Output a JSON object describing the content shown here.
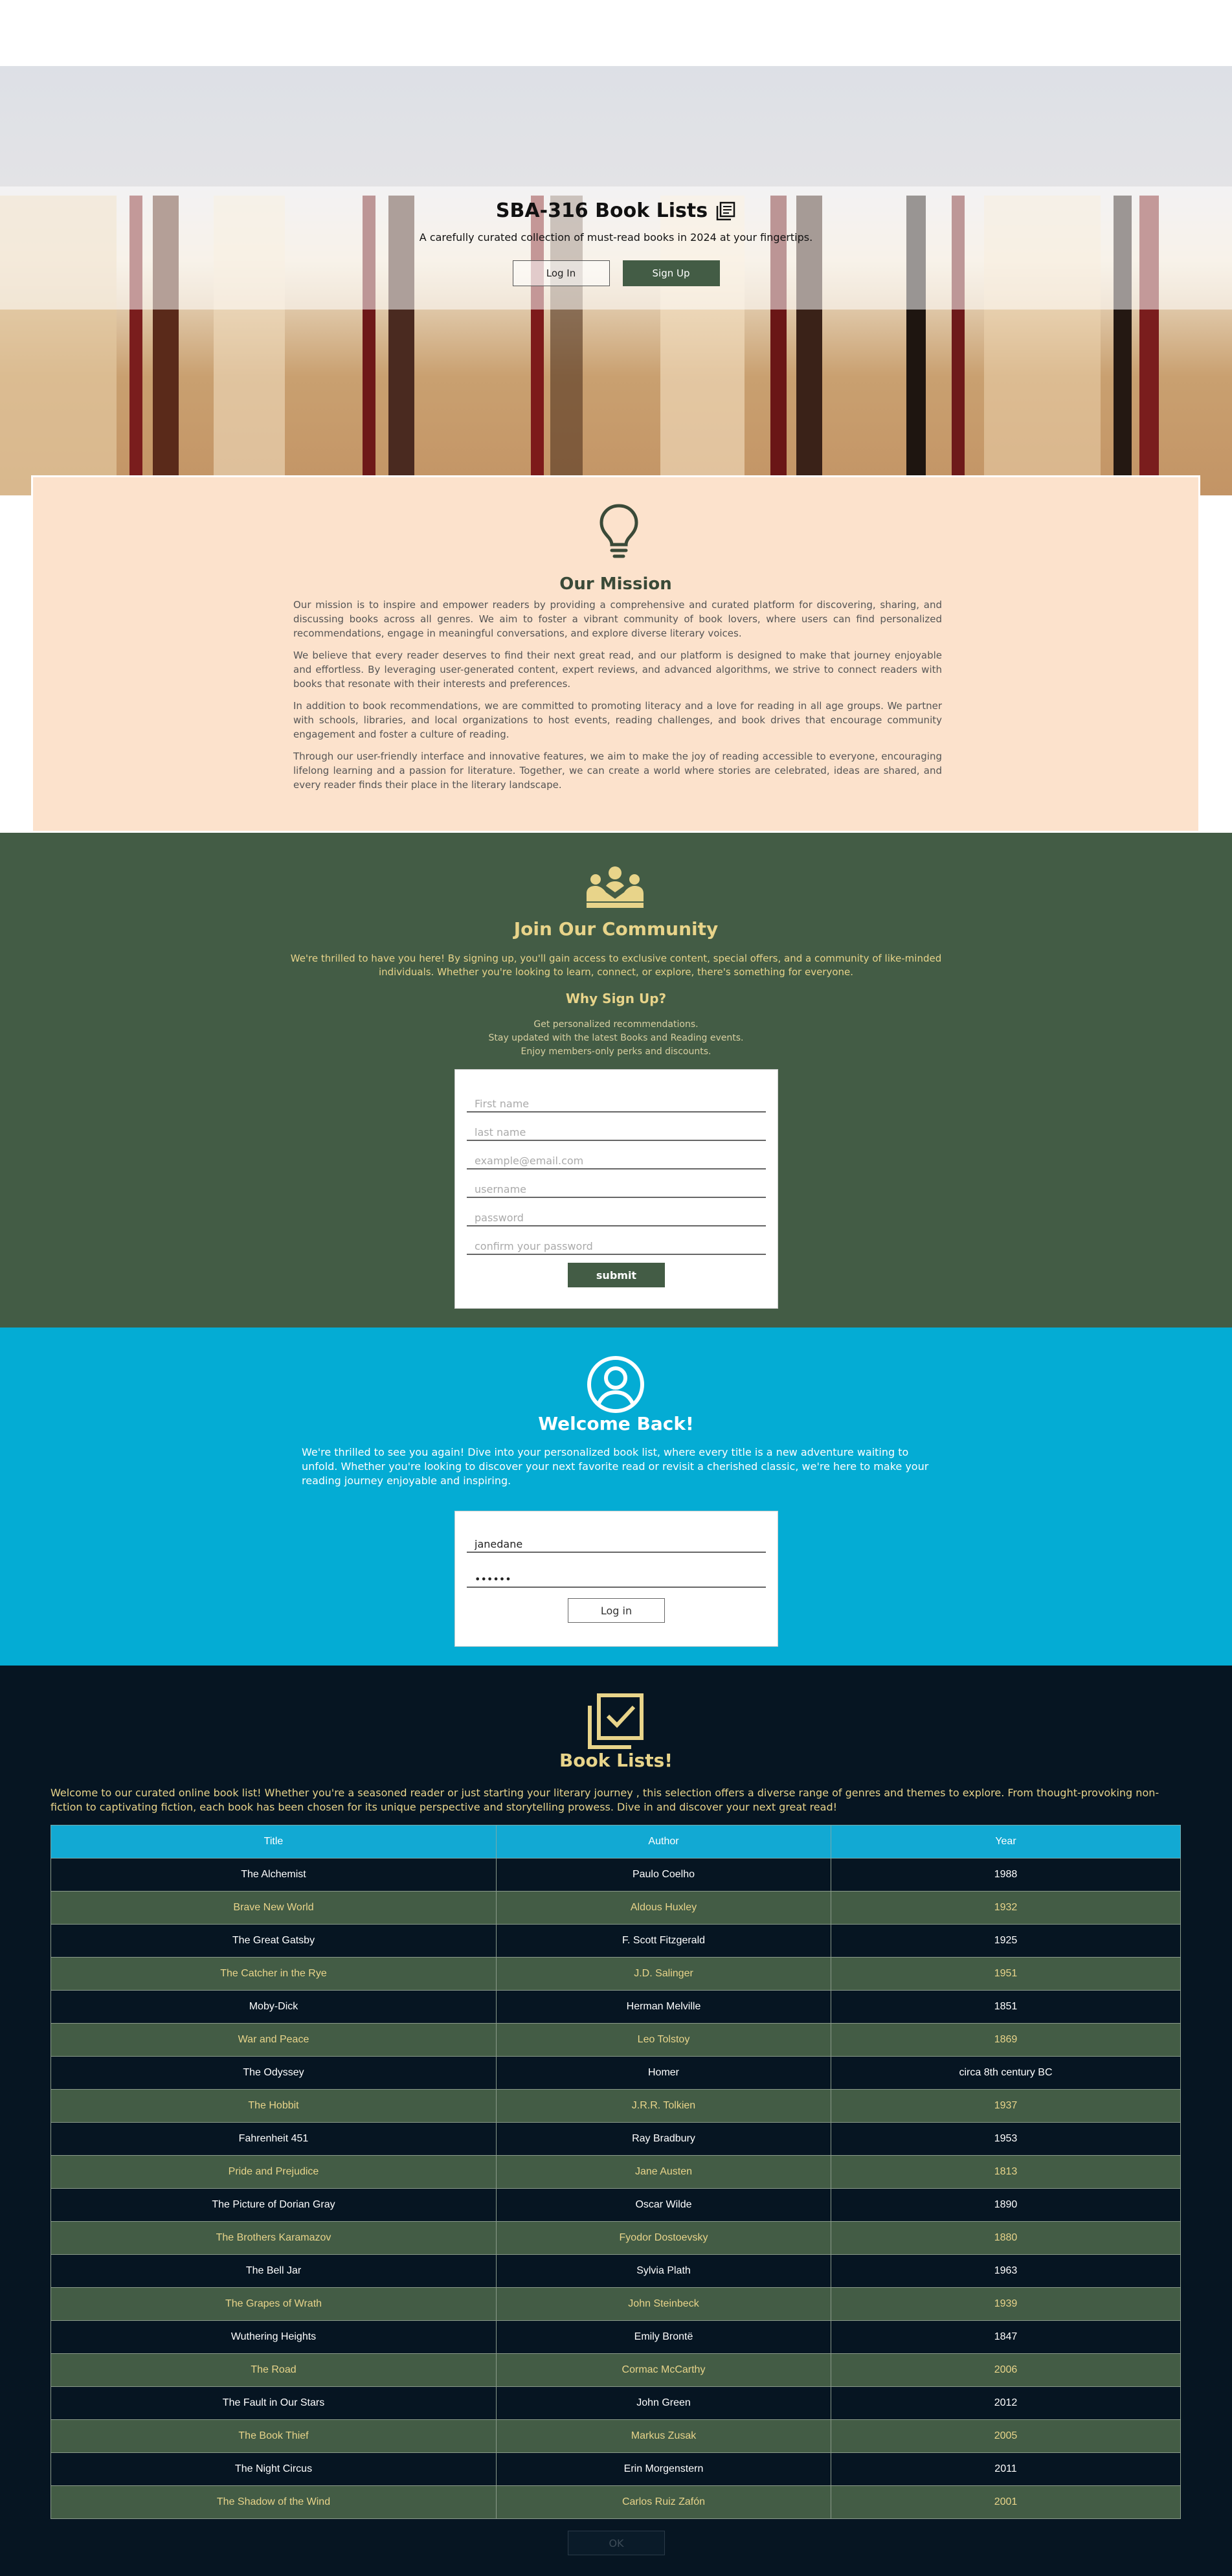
{
  "hero": {
    "title": "SBA-316 Book Lists",
    "subtitle": "A carefully curated collection of must-read books in 2024 at your fingertips.",
    "login_label": "Log In",
    "signup_label": "Sign Up"
  },
  "mission": {
    "heading": "Our Mission",
    "paragraphs": [
      "Our mission is to inspire and empower readers by providing a comprehensive and curated platform for discovering, sharing, and discussing books across all genres. We aim to foster a vibrant community of book lovers, where users can find personalized recommendations, engage in meaningful conversations, and explore diverse literary voices.",
      "We believe that every reader deserves to find their next great read, and our platform is designed to make that journey enjoyable and effortless. By leveraging user-generated content, expert reviews, and advanced algorithms, we strive to connect readers with books that resonate with their interests and preferences.",
      "In addition to book recommendations, we are committed to promoting literacy and a love for reading in all age groups. We partner with schools, libraries, and local organizations to host events, reading challenges, and book drives that encourage community engagement and foster a culture of reading.",
      "Through our user-friendly interface and innovative features, we aim to make the joy of reading accessible to everyone, encouraging lifelong learning and a passion for literature. Together, we can create a world where stories are celebrated, ideas are shared, and every reader finds their place in the literary landscape."
    ]
  },
  "community": {
    "heading": "Join Our Community",
    "intro": "We're thrilled to have you here! By signing up, you'll gain access to exclusive content, special offers, and a community of like-minded individuals. Whether you're looking to learn, connect, or explore, there's something for everyone.",
    "why_heading": "Why Sign Up?",
    "why_items": [
      "Get personalized recommendations.",
      "Stay updated with the latest Books and Reading events.",
      "Enjoy members-only perks and discounts."
    ],
    "form": {
      "first_name_placeholder": "First name",
      "last_name_placeholder": "last name",
      "email_placeholder": "example@email.com",
      "username_placeholder": "username",
      "password_placeholder": "password",
      "confirm_placeholder": "confirm your password",
      "submit_label": "submit"
    }
  },
  "welcome": {
    "heading": "Welcome Back!",
    "text": "We're thrilled to see you again! Dive into your personalized book list, where every title is a new adventure waiting to unfold. Whether you're looking to discover your next favorite read or revisit a cherished classic, we're here to make your reading journey enjoyable and inspiring.",
    "username_value": "janedane",
    "password_value": "••••••",
    "login_label": "Log in"
  },
  "books": {
    "heading": "Book Lists!",
    "intro": "Welcome to our curated online book list! Whether you're a seasoned reader or just starting your literary journey , this selection offers a diverse range of genres and themes to explore. From thought-provoking non-fiction to captivating fiction, each book has been chosen for its unique perspective and storytelling prowess. Dive in and discover your next great read!",
    "columns": [
      "Title",
      "Author",
      "Year"
    ],
    "rows": [
      [
        "The Alchemist",
        "Paulo Coelho",
        "1988"
      ],
      [
        "Brave New World",
        "Aldous Huxley",
        "1932"
      ],
      [
        "The Great Gatsby",
        "F. Scott Fitzgerald",
        "1925"
      ],
      [
        "The Catcher in the Rye",
        "J.D. Salinger",
        "1951"
      ],
      [
        "Moby-Dick",
        "Herman Melville",
        "1851"
      ],
      [
        "War and Peace",
        "Leo Tolstoy",
        "1869"
      ],
      [
        "The Odyssey",
        "Homer",
        "circa 8th century BC"
      ],
      [
        "The Hobbit",
        "J.R.R. Tolkien",
        "1937"
      ],
      [
        "Fahrenheit 451",
        "Ray Bradbury",
        "1953"
      ],
      [
        "Pride and Prejudice",
        "Jane Austen",
        "1813"
      ],
      [
        "The Picture of Dorian Gray",
        "Oscar Wilde",
        "1890"
      ],
      [
        "The Brothers Karamazov",
        "Fyodor Dostoevsky",
        "1880"
      ],
      [
        "The Bell Jar",
        "Sylvia Plath",
        "1963"
      ],
      [
        "The Grapes of Wrath",
        "John Steinbeck",
        "1939"
      ],
      [
        "Wuthering Heights",
        "Emily Brontë",
        "1847"
      ],
      [
        "The Road",
        "Cormac McCarthy",
        "2006"
      ],
      [
        "The Fault in Our Stars",
        "John Green",
        "2012"
      ],
      [
        "The Book Thief",
        "Markus Zusak",
        "2005"
      ],
      [
        "The Night Circus",
        "Erin Morgenstern",
        "2011"
      ],
      [
        "The Shadow of the Wind",
        "Carlos Ruiz Zafón",
        "2001"
      ]
    ],
    "ok_label": "OK"
  },
  "colors": {
    "dark_green": "#435c45",
    "peach": "#fce2cc",
    "cyan": "#04acd4",
    "navy": "#061522",
    "gold": "#e8d48a"
  }
}
